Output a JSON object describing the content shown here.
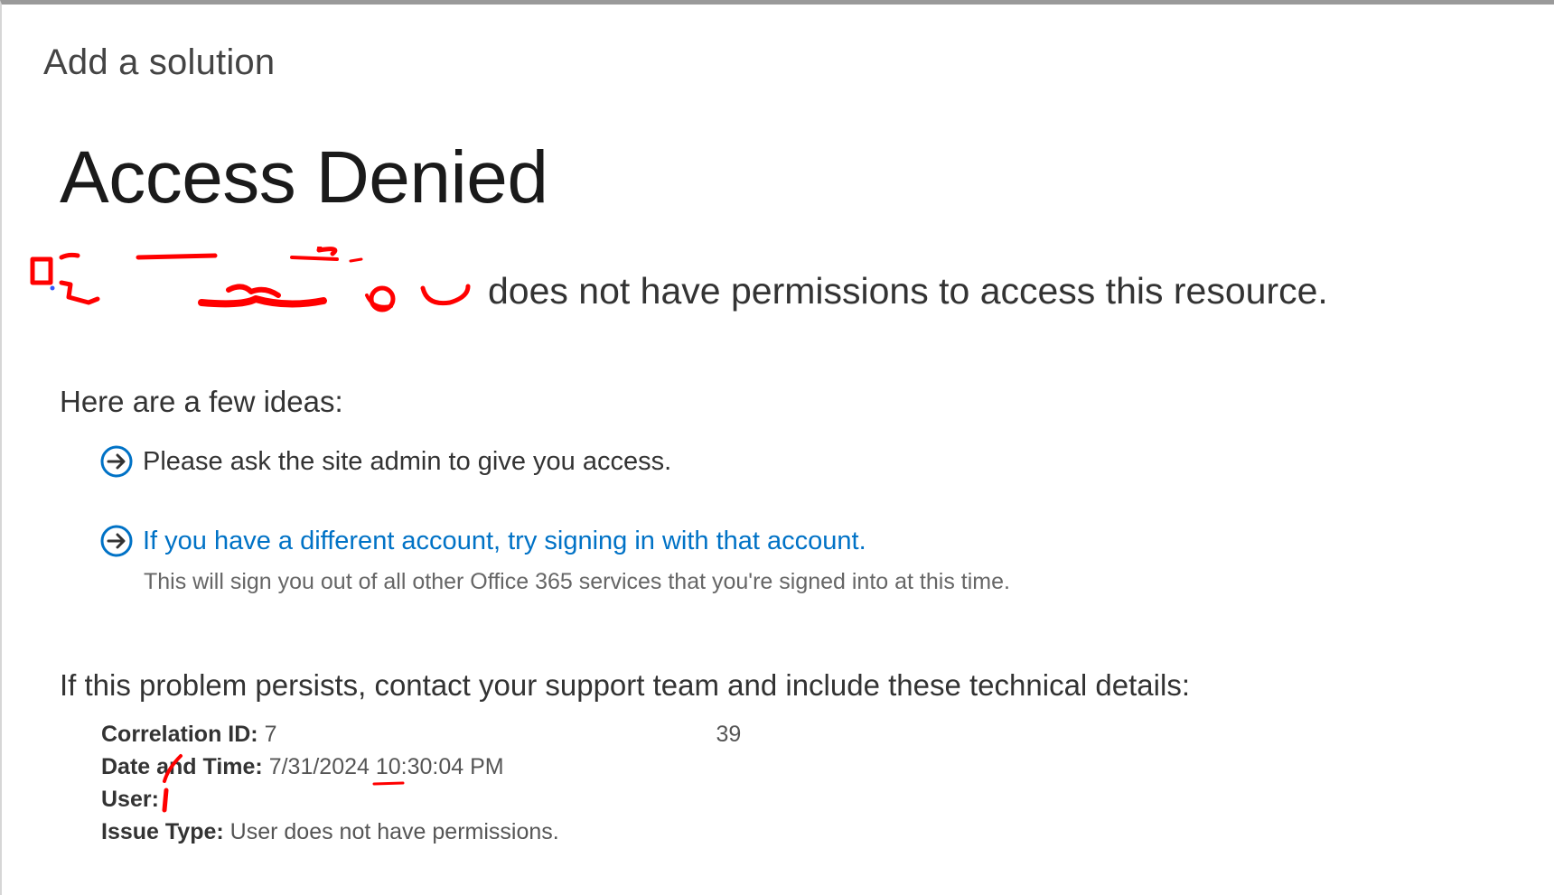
{
  "dialog": {
    "title": "Add a solution"
  },
  "error": {
    "heading": "Access Denied",
    "permission_message": "does not have permissions to access this resource."
  },
  "ideas": {
    "heading": "Here are a few ideas:",
    "items": [
      {
        "text": "Please ask the site admin to give you access.",
        "icon": "circle-arrow-right-icon"
      },
      {
        "text": "If you have a different account, try signing in with that account.",
        "icon": "circle-arrow-right-icon",
        "note": "This will sign you out of all other Office 365 services that you're signed into at this time."
      }
    ]
  },
  "support": {
    "heading": "If this problem persists, contact your support team and include these technical details:",
    "details": [
      {
        "label": "Correlation ID:",
        "value": "7"
      },
      {
        "label": "Date and Time:",
        "value": "7/31/2024 10:30:04 PM"
      },
      {
        "label": "User:",
        "value": ""
      },
      {
        "label": "Issue Type:",
        "value": "User does not have permissions."
      }
    ],
    "correlation_id_suffix": "39"
  },
  "colors": {
    "link": "#0072c6",
    "redaction": "#ff0000",
    "icon": "#0072c6"
  }
}
